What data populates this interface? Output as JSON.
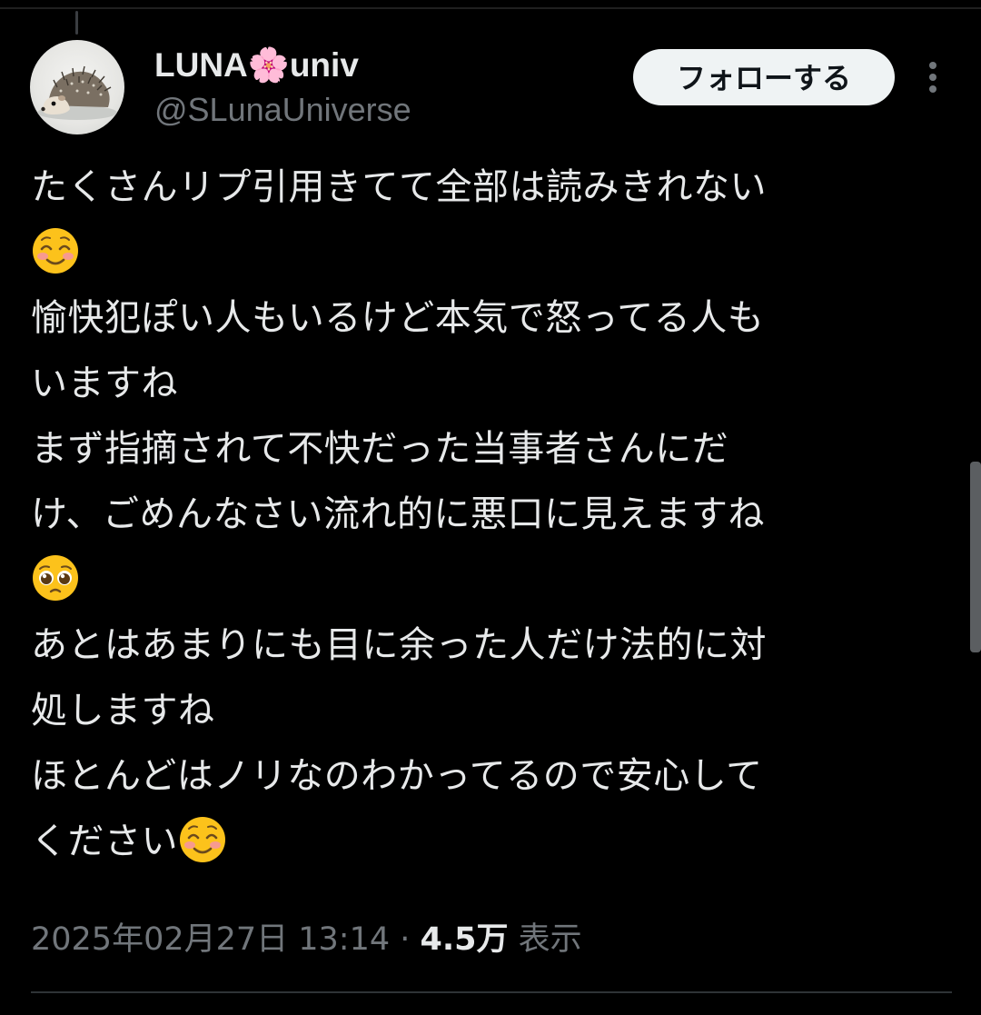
{
  "author": {
    "display_name": "LUNA🌸univ",
    "handle": "@SLunaUniverse",
    "avatar_icon": "hedgehog-avatar"
  },
  "actions": {
    "follow_label": "フォローする",
    "more_icon": "more-vertical-icon"
  },
  "tweet": {
    "lines": [
      "たくさんリプ引用きてて全部は読みきれない",
      "",
      "愉快犯ぽい人もいるけど本気で怒ってる人も",
      "いますね",
      "まず指摘されて不快だった当事者さんにだ",
      "け、ごめんなさい流れ的に悪口に見えますね",
      "",
      "あとはあまりにも目に余った人だけ法的に対",
      "処しますね",
      "ほとんどはノリなのわかってるので安心して",
      "ください"
    ],
    "emojis": {
      "smiling": "smiling-face-icon",
      "pleading": "pleading-face-icon"
    }
  },
  "meta": {
    "timestamp": "2025年02月27日 13:14",
    "separator": " · ",
    "views_count": "4.5万",
    "views_label": " 表示"
  },
  "colors": {
    "background": "#000000",
    "text_primary": "#e7e9ea",
    "text_secondary": "#71767b",
    "follow_bg": "#eff3f4",
    "divider": "#2f3336"
  }
}
